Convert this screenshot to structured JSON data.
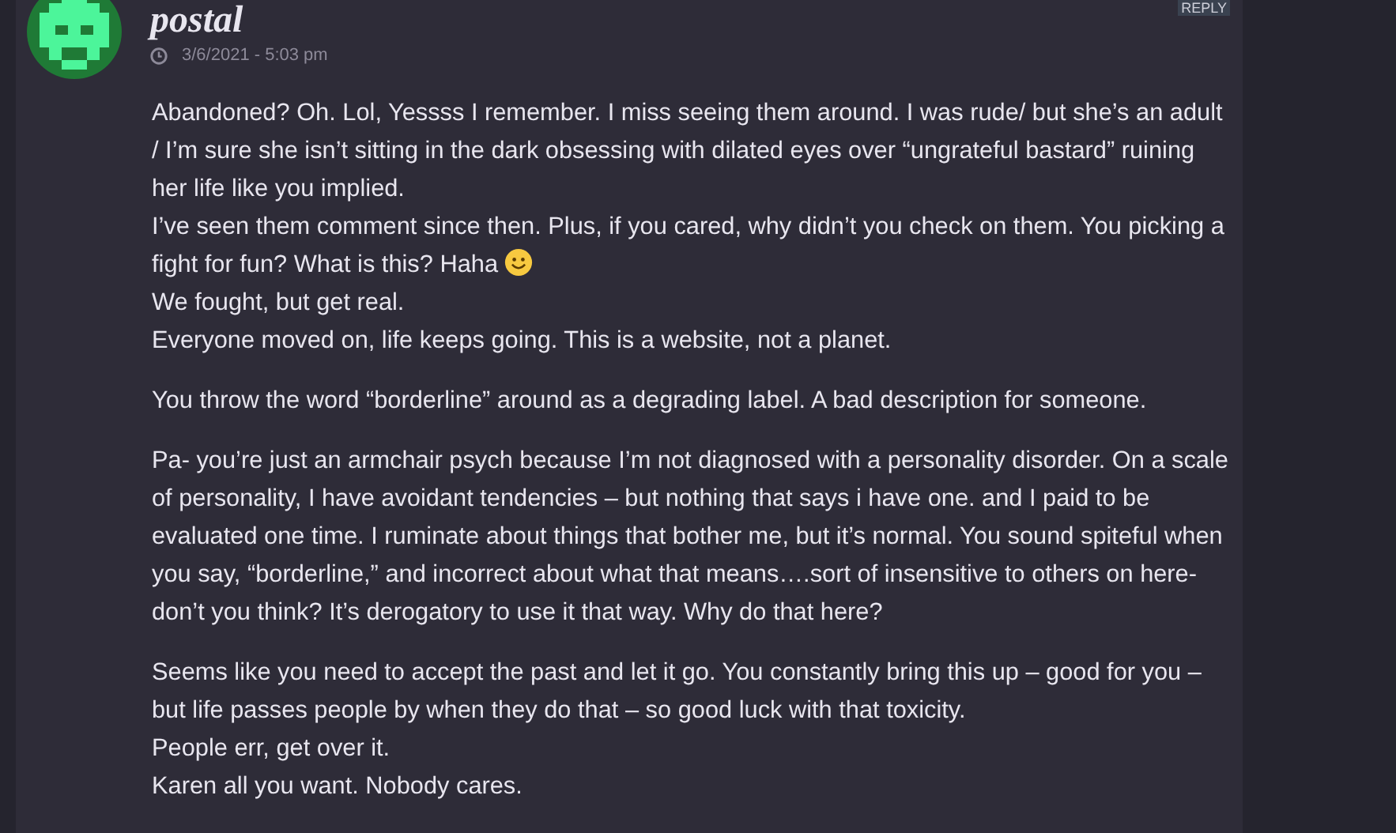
{
  "comment": {
    "author": "postal",
    "timestamp": "3/6/2021 - 5:03 pm",
    "reply_link": "REPLY",
    "paragraphs": [
      {
        "lines": [
          {
            "kind": "text",
            "text": "Abandoned? Oh. Lol, Yessss I remember. I miss seeing them around. I was rude/ but she’s an adult / I’m sure she isn’t sitting in the dark obsessing with dilated eyes over “ungrateful bastard” ruining her life like you implied."
          },
          {
            "text": "I’ve seen them comment since then. Plus, if you cared, why didn’t you check on them. You picking a fight for fun? What is this? Haha",
            "kind": "text_smiley"
          },
          {
            "kind": "text",
            "text": "We fought, but get real."
          },
          {
            "kind": "text",
            "text": "Everyone moved on, life keeps going. This is a website, not a planet."
          }
        ]
      },
      {
        "lines": [
          {
            "kind": "text",
            "text": "You throw the word “borderline” around as a degrading label. A bad description for someone."
          }
        ]
      },
      {
        "lines": [
          {
            "kind": "text",
            "text": "Pa- you’re just an armchair psych because I’m not diagnosed with a personality disorder. On a scale of personality, I have avoidant tendencies – but nothing that says i have one. and I paid to be evaluated one time. I ruminate about things that bother me, but it’s normal. You sound spiteful when you say, “borderline,” and incorrect about what that means….sort of insensitive to others on here- don’t you think? It’s derogatory to use it that way. Why do that here?"
          }
        ]
      },
      {
        "lines": [
          {
            "kind": "text",
            "text": "Seems like you need to accept the past and let it go. You constantly bring this up – good for you – but life passes people by when they do that – so good luck with that toxicity."
          },
          {
            "kind": "text",
            "text": "People err, get over it."
          },
          {
            "kind": "text",
            "text": "Karen all you want. Nobody cares."
          }
        ]
      }
    ]
  }
}
